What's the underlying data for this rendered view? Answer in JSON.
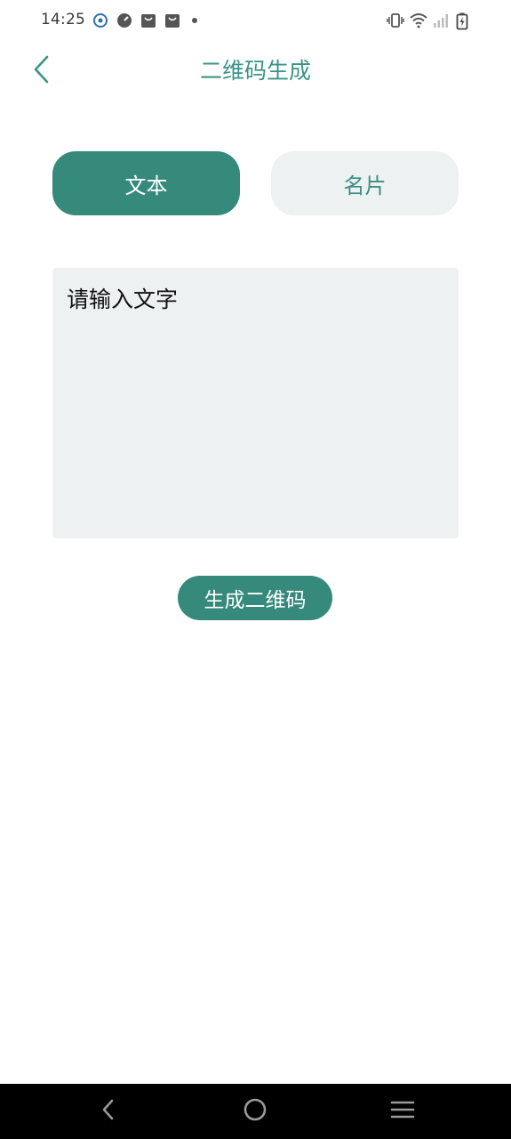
{
  "status_bar": {
    "time": "14:25",
    "left_icons": [
      "app-notification-icon",
      "speedometer-icon",
      "shopping-bag-icon",
      "shopping-bag-icon",
      "more-dot-icon"
    ],
    "right_icons": [
      "vibrate-icon",
      "wifi-icon",
      "cellular-signal-icon",
      "battery-charging-icon"
    ]
  },
  "header": {
    "title": "二维码生成",
    "back_icon": "chevron-left-icon"
  },
  "tabs": [
    {
      "label": "文本",
      "active": true
    },
    {
      "label": "名片",
      "active": false
    }
  ],
  "input": {
    "placeholder": "请输入文字",
    "value": ""
  },
  "actions": {
    "generate_label": "生成二维码"
  },
  "colors": {
    "accent": "#358a7b",
    "title": "#3a9486",
    "surface": "#edf1f2",
    "nav_bar": "#000000"
  },
  "nav_bar": {
    "buttons": [
      "back-icon",
      "home-icon",
      "menu-icon"
    ]
  }
}
